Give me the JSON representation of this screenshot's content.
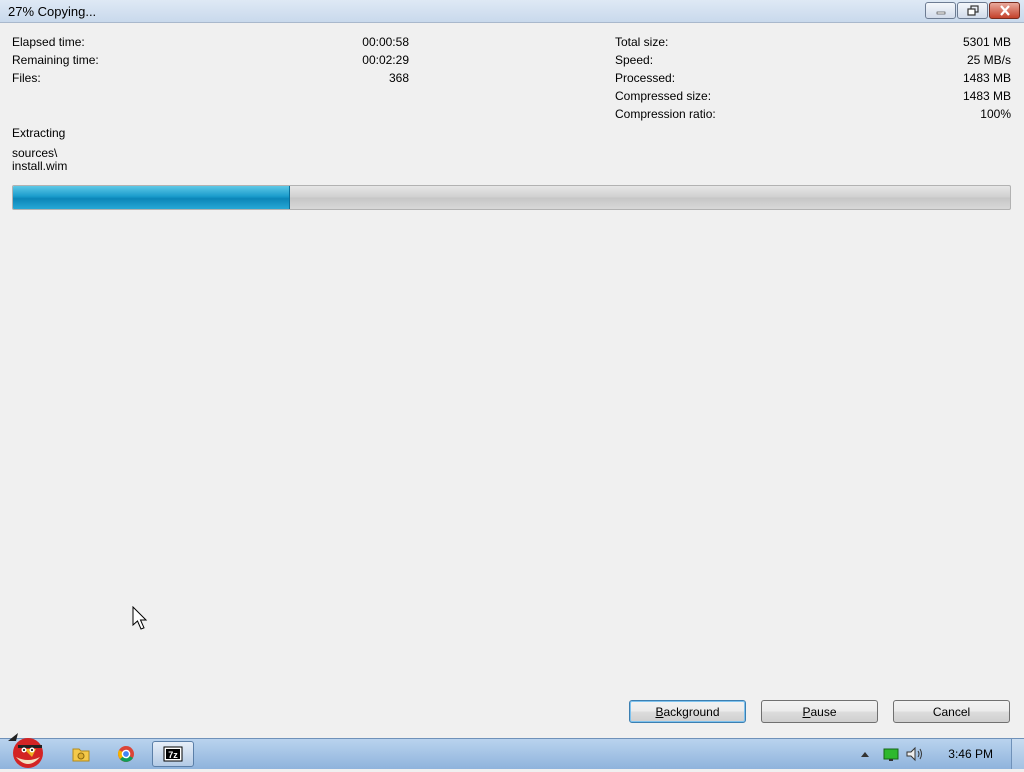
{
  "window": {
    "title": "27% Copying..."
  },
  "left_stats": [
    {
      "label": "Elapsed time:",
      "value": "00:00:58"
    },
    {
      "label": "Remaining time:",
      "value": "00:02:29"
    },
    {
      "label": "Files:",
      "value": "368"
    }
  ],
  "right_stats": [
    {
      "label": "Total size:",
      "value": "5301 MB"
    },
    {
      "label": "Speed:",
      "value": "25 MB/s"
    },
    {
      "label": "Processed:",
      "value": "1483 MB"
    },
    {
      "label": "Compressed size:",
      "value": "1483 MB"
    },
    {
      "label": "Compression ratio:",
      "value": "100%"
    }
  ],
  "operation": {
    "label": "Extracting",
    "path_line1": "sources\\",
    "path_line2": "install.wim"
  },
  "progress": {
    "fraction": 0.277,
    "color": "#1a9ccc"
  },
  "buttons": {
    "background": {
      "mnemonic": "B",
      "rest": "ackground"
    },
    "pause": {
      "mnemonic": "P",
      "rest": "ause"
    },
    "cancel": "Cancel"
  },
  "taskbar": {
    "items": [
      "angry-birds-start-icon",
      "explorer-folder-icon",
      "chrome-icon",
      "7zip-icon"
    ],
    "clock": "3:46 PM"
  }
}
